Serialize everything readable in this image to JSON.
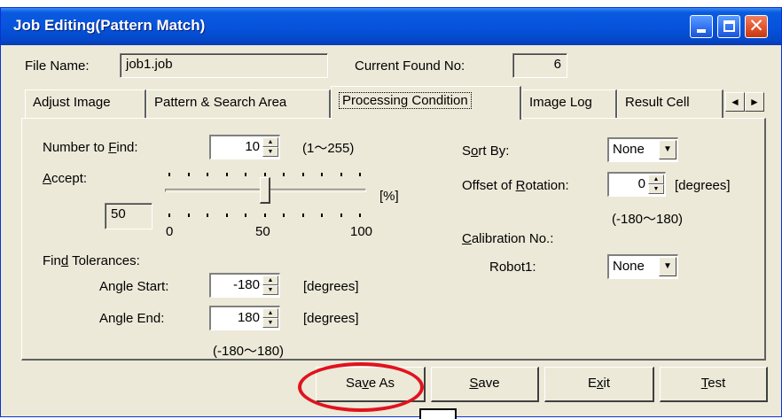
{
  "window": {
    "title": "Job Editing(Pattern Match)"
  },
  "header": {
    "file_name_label": "File Name:",
    "file_name_value": "job1.job",
    "found_label": "Current Found No:",
    "found_value": "6"
  },
  "tabs": [
    {
      "label": "Adjust Image"
    },
    {
      "label": "Pattern & Search Area"
    },
    {
      "label": "Processing Condition"
    },
    {
      "label": "Image Log"
    },
    {
      "label": "Result Cell"
    }
  ],
  "tab_arrows": {
    "left": "◄",
    "right": "►"
  },
  "processing": {
    "number_to_find": {
      "pre": "Number to ",
      "mnemonic": "F",
      "post": "ind:",
      "value": "10",
      "range": "(1～255)"
    },
    "accept": {
      "mnemonic": "A",
      "post": "ccept:",
      "value": "50",
      "unit": "[%]",
      "tick_min": "0",
      "tick_mid": "50",
      "tick_max": "100",
      "slider_fraction": 0.5
    },
    "find_tolerances": {
      "pre": "Fin",
      "mnemonic": "d",
      "post": " Tolerances:"
    },
    "angle_start": {
      "label": "Angle Start:",
      "value": "-180",
      "unit": "[degrees]"
    },
    "angle_end": {
      "label": "Angle End:",
      "value": "180",
      "unit": "[degrees]"
    },
    "angle_range": "(-180～180)",
    "sort_by": {
      "pre": "S",
      "mnemonic": "o",
      "post": "rt By:",
      "value": "None"
    },
    "offset_rotation": {
      "pre": "Offset of ",
      "mnemonic": "R",
      "post": "otation:",
      "value": "0",
      "unit": "[degrees]",
      "range": "(-180～180)"
    },
    "calibration": {
      "mnemonic": "C",
      "post": "alibration No.:"
    },
    "robot1": {
      "label": "Robot1:",
      "value": "None"
    }
  },
  "buttons": {
    "save_as": {
      "pre": "Sa",
      "mnemonic": "v",
      "post": "e As"
    },
    "save": {
      "pre": "",
      "mnemonic": "S",
      "post": "ave"
    },
    "exit": {
      "pre": "E",
      "mnemonic": "x",
      "post": "it"
    },
    "test": {
      "pre": "",
      "mnemonic": "T",
      "post": "est"
    }
  },
  "icons": {
    "spin_up": "▲",
    "spin_down": "▼",
    "combo_arrow": "▼",
    "close": "✕"
  },
  "colors": {
    "title_bar": "#0654dc",
    "highlight": "#e0131f",
    "face": "#ece9d8"
  }
}
